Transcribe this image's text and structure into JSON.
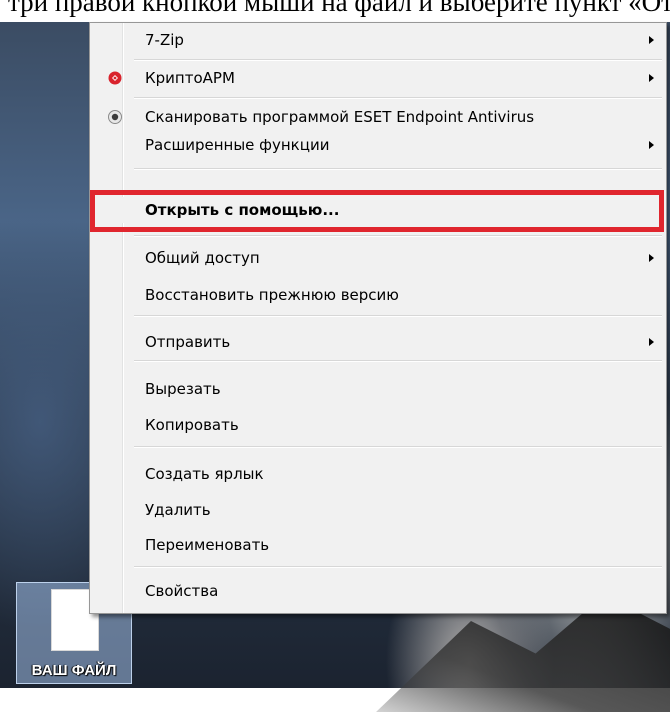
{
  "document": {
    "cut_text": "три правой кнопкой мыши на файл и выберите пункт «Открыть с помощью»"
  },
  "desktop_icon": {
    "label": "ВАШ ФАЙЛ"
  },
  "menu": {
    "items": [
      {
        "id": "7zip",
        "label": "7-Zip",
        "submenu": true
      },
      {
        "id": "cryptoarm",
        "label": "КриптоАРМ",
        "submenu": true,
        "icon": "cryptoarm-icon"
      },
      {
        "id": "eset",
        "label": "Сканировать программой ESET Endpoint Antivirus",
        "submenu": false,
        "icon": "eset-icon"
      },
      {
        "id": "advanced",
        "label": "Расширенные функции",
        "submenu": true
      },
      {
        "id": "open_with",
        "label": "Открыть с помощью...",
        "submenu": false,
        "bold": true,
        "highlighted": true
      },
      {
        "id": "share",
        "label": "Общий доступ",
        "submenu": true
      },
      {
        "id": "restore",
        "label": "Восстановить прежнюю версию",
        "submenu": false
      },
      {
        "id": "send_to",
        "label": "Отправить",
        "submenu": true
      },
      {
        "id": "cut",
        "label": "Вырезать",
        "submenu": false
      },
      {
        "id": "copy",
        "label": "Копировать",
        "submenu": false
      },
      {
        "id": "shortcut",
        "label": "Создать ярлык",
        "submenu": false
      },
      {
        "id": "delete",
        "label": "Удалить",
        "submenu": false
      },
      {
        "id": "rename",
        "label": "Переименовать",
        "submenu": false
      },
      {
        "id": "properties",
        "label": "Свойства",
        "submenu": false
      }
    ]
  },
  "colors": {
    "highlight_border": "#e0262e",
    "menu_bg": "#f1f1f1",
    "cryptoarm_icon": "#d9232d"
  }
}
